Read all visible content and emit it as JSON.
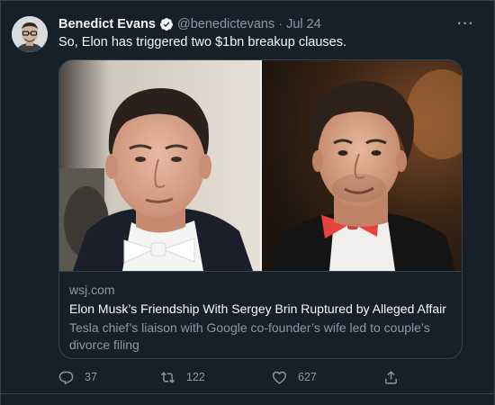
{
  "tweet": {
    "author_name": "Benedict Evans",
    "handle": "@benedictevans",
    "separator": "·",
    "date": "Jul 24",
    "text": "So, Elon has triggered two $1bn breakup clauses.",
    "verified": true
  },
  "card": {
    "domain": "wsj.com",
    "title": "Elon Musk’s Friendship With Sergey Brin Ruptured by Alleged Affair",
    "description": "Tesla chief’s liaison with Google co-founder’s wife led to couple’s divorce filing",
    "images": [
      "elon-musk-photo",
      "sergey-brin-photo"
    ]
  },
  "actions": {
    "replies": "37",
    "retweets": "122",
    "likes": "627"
  },
  "colors": {
    "background": "#15202b",
    "border": "#38444d",
    "muted_text": "#8b98a5",
    "primary_text": "#f7f9f9",
    "verified_badge": "#f7f9f9",
    "bow_tie_red": "#e8423c"
  },
  "icons": [
    "verified-badge-icon",
    "more-icon",
    "reply-icon",
    "retweet-icon",
    "like-icon",
    "share-icon"
  ]
}
